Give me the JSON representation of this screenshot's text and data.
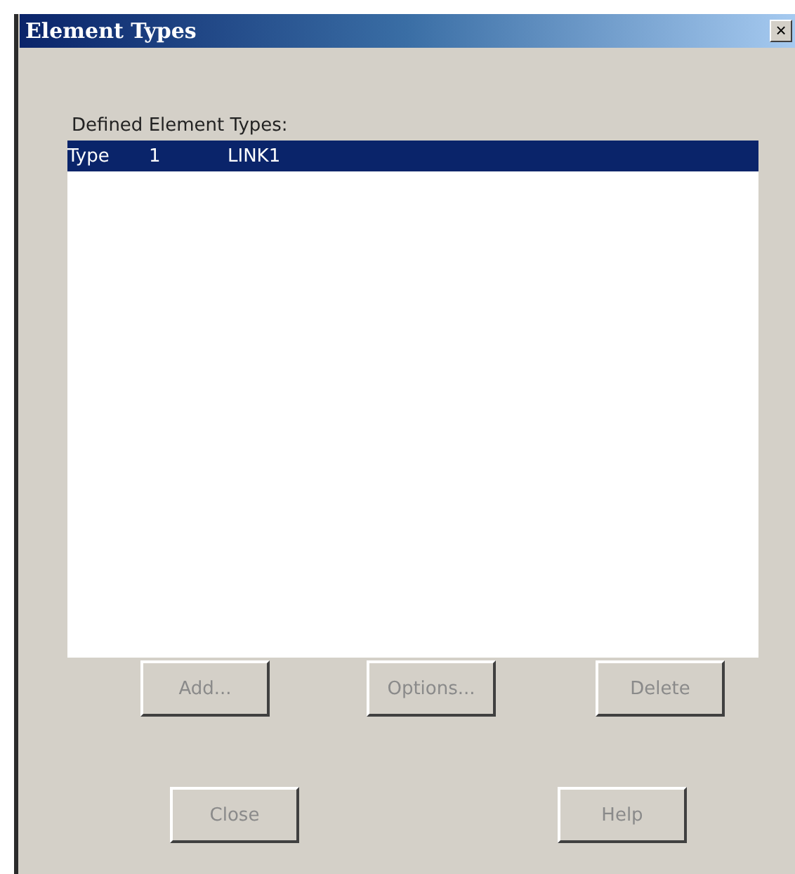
{
  "window": {
    "title": "Element Types",
    "close_glyph": "×"
  },
  "list": {
    "label": "Defined Element Types:",
    "items": [
      {
        "columns": [
          "Type",
          "1",
          "LINK1"
        ],
        "selected": true
      }
    ]
  },
  "action_buttons": [
    {
      "label": "Add...",
      "disabled": true
    },
    {
      "label": "Options...",
      "disabled": true
    },
    {
      "label": "Delete",
      "disabled": true
    }
  ],
  "footer_buttons": [
    {
      "label": "Close",
      "disabled": true
    },
    {
      "label": "Help",
      "disabled": true
    }
  ]
}
